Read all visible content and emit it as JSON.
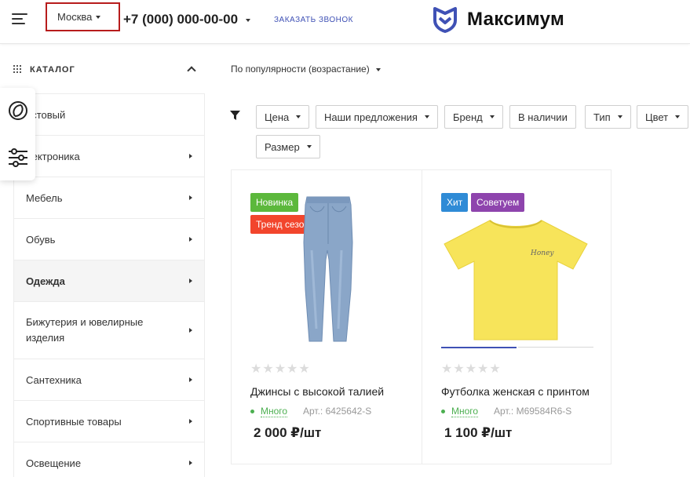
{
  "header": {
    "city": "Москва",
    "phone": "+7 (000) 000-00-00",
    "callback": "ЗАКАЗАТЬ ЗВОНОК",
    "logo_text": "Максимум",
    "accent": "#3f51b5"
  },
  "sidebar": {
    "catalog_label": "КАТАЛОГ",
    "items": [
      {
        "label": "естовый",
        "has_arrow": false
      },
      {
        "label": "лектроника",
        "has_arrow": true
      },
      {
        "label": "Мебель",
        "has_arrow": true
      },
      {
        "label": "Обувь",
        "has_arrow": true
      },
      {
        "label": "Одежда",
        "has_arrow": true,
        "active": true
      },
      {
        "label": "Бижутерия и ювелирные изделия",
        "has_arrow": true
      },
      {
        "label": "Сантехника",
        "has_arrow": true
      },
      {
        "label": "Спортивные товары",
        "has_arrow": true
      },
      {
        "label": "Освещение",
        "has_arrow": true
      }
    ]
  },
  "sort": {
    "label": "По популярности (возрастание)"
  },
  "filters": [
    {
      "label": "Цена",
      "has_caret": true
    },
    {
      "label": "Наши предложения",
      "has_caret": true
    },
    {
      "label": "Бренд",
      "has_caret": true
    },
    {
      "label": "В наличии",
      "has_caret": false
    },
    {
      "label": "Тип",
      "has_caret": true
    },
    {
      "label": "Цвет",
      "has_caret": true
    },
    {
      "label": "Размер",
      "has_caret": true
    }
  ],
  "products": [
    {
      "badges": [
        {
          "label": "Новинка",
          "color": "#5cb83c"
        },
        {
          "label": "Тренд сезона",
          "color": "#f2452c"
        }
      ],
      "name": "Джинсы с высокой талией",
      "stock": "Много",
      "article": "Арт.: 6425642-S",
      "price": "2 000 ₽/шт",
      "rating": 0
    },
    {
      "badges": [
        {
          "label": "Хит",
          "color": "#2f8bd6"
        },
        {
          "label": "Советуем",
          "color": "#8e44ad"
        }
      ],
      "name": "Футболка женская с принтом",
      "stock": "Много",
      "article": "Арт.: M69584R6-S",
      "price": "1 100 ₽/шт",
      "rating": 0,
      "print_text": "Honey"
    }
  ]
}
